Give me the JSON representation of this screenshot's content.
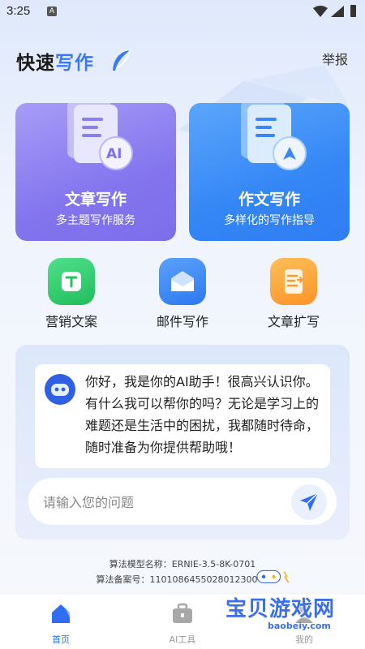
{
  "status_bar": {
    "time": "3:25",
    "notification_icon": "a-letter-icon"
  },
  "header": {
    "title_part1": "快速",
    "title_part2": "写作",
    "report_label": "举报"
  },
  "cards": [
    {
      "title": "文章写作",
      "subtitle": "多主题写作服务",
      "badge": "AI"
    },
    {
      "title": "作文写作",
      "subtitle": "多样化的写作指导"
    }
  ],
  "tools": [
    {
      "label": "营销文案",
      "icon": "text-t-icon",
      "color": "#2fc86a"
    },
    {
      "label": "邮件写作",
      "icon": "envelope-icon",
      "color": "#3385f6"
    },
    {
      "label": "文章扩写",
      "icon": "document-expand-icon",
      "color": "#fb9c34"
    }
  ],
  "chat": {
    "greeting": "你好，我是你的AI助手！很高兴认识你。有什么我可以帮你的吗？无论是学习上的难题还是生活中的困扰，我都随时待命，随时准备为你提供帮助哦！",
    "input_placeholder": "请输入您的问题"
  },
  "footer": {
    "algo_name": "算法模型名称：ERNIE-3.5-8K-0701",
    "algo_record": "算法备案号：110108645502801230043"
  },
  "tabs": [
    {
      "label": "首页",
      "icon": "home-icon",
      "active": true
    },
    {
      "label": "AI工具",
      "icon": "toolbox-icon",
      "active": false
    },
    {
      "label": "我的",
      "icon": "user-icon",
      "active": false
    }
  ],
  "watermark": {
    "text": "宝贝游戏网",
    "url": "baobeiy.com"
  },
  "colors": {
    "accent": "#3d78f3",
    "card1": "#8a7cf0",
    "card2": "#3486f6"
  }
}
